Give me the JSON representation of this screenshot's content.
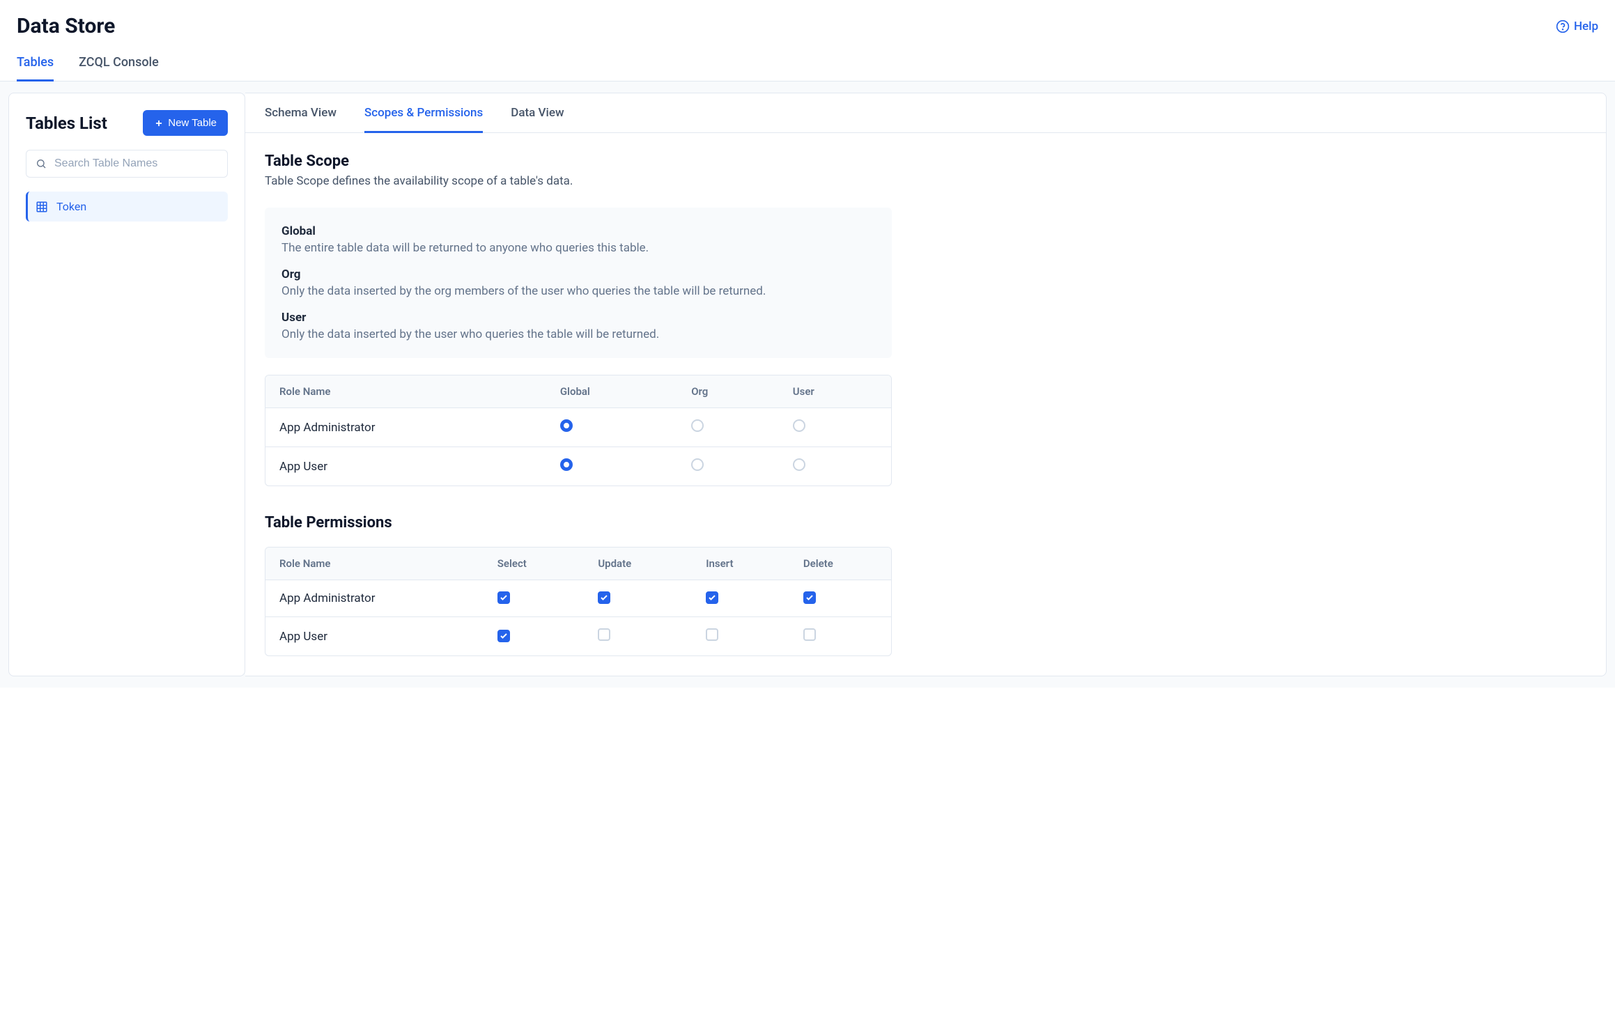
{
  "page_title": "Data Store",
  "help_label": "Help",
  "top_tabs": [
    {
      "label": "Tables",
      "active": true
    },
    {
      "label": "ZCQL Console",
      "active": false
    }
  ],
  "sidebar": {
    "title": "Tables List",
    "new_table_label": "New Table",
    "search_placeholder": "Search Table Names",
    "tables": [
      {
        "name": "Token",
        "active": true
      }
    ]
  },
  "sub_tabs": [
    {
      "label": "Schema View",
      "active": false
    },
    {
      "label": "Scopes & Permissions",
      "active": true
    },
    {
      "label": "Data View",
      "active": false
    }
  ],
  "table_scope": {
    "title": "Table Scope",
    "desc": "Table Scope defines the availability scope of a table's data.",
    "info": [
      {
        "label": "Global",
        "text": "The entire table data will be returned to anyone who queries this table."
      },
      {
        "label": "Org",
        "text": "Only the data inserted by the org members of the user who queries the table will be returned."
      },
      {
        "label": "User",
        "text": "Only the data inserted by the user who queries the table will be returned."
      }
    ],
    "columns": [
      "Role Name",
      "Global",
      "Org",
      "User"
    ],
    "rows": [
      {
        "role": "App Administrator",
        "selected": "Global"
      },
      {
        "role": "App User",
        "selected": "Global"
      }
    ]
  },
  "table_permissions": {
    "title": "Table Permissions",
    "columns": [
      "Role Name",
      "Select",
      "Update",
      "Insert",
      "Delete"
    ],
    "rows": [
      {
        "role": "App Administrator",
        "select": true,
        "update": true,
        "insert": true,
        "delete": true
      },
      {
        "role": "App User",
        "select": true,
        "update": false,
        "insert": false,
        "delete": false
      }
    ]
  }
}
